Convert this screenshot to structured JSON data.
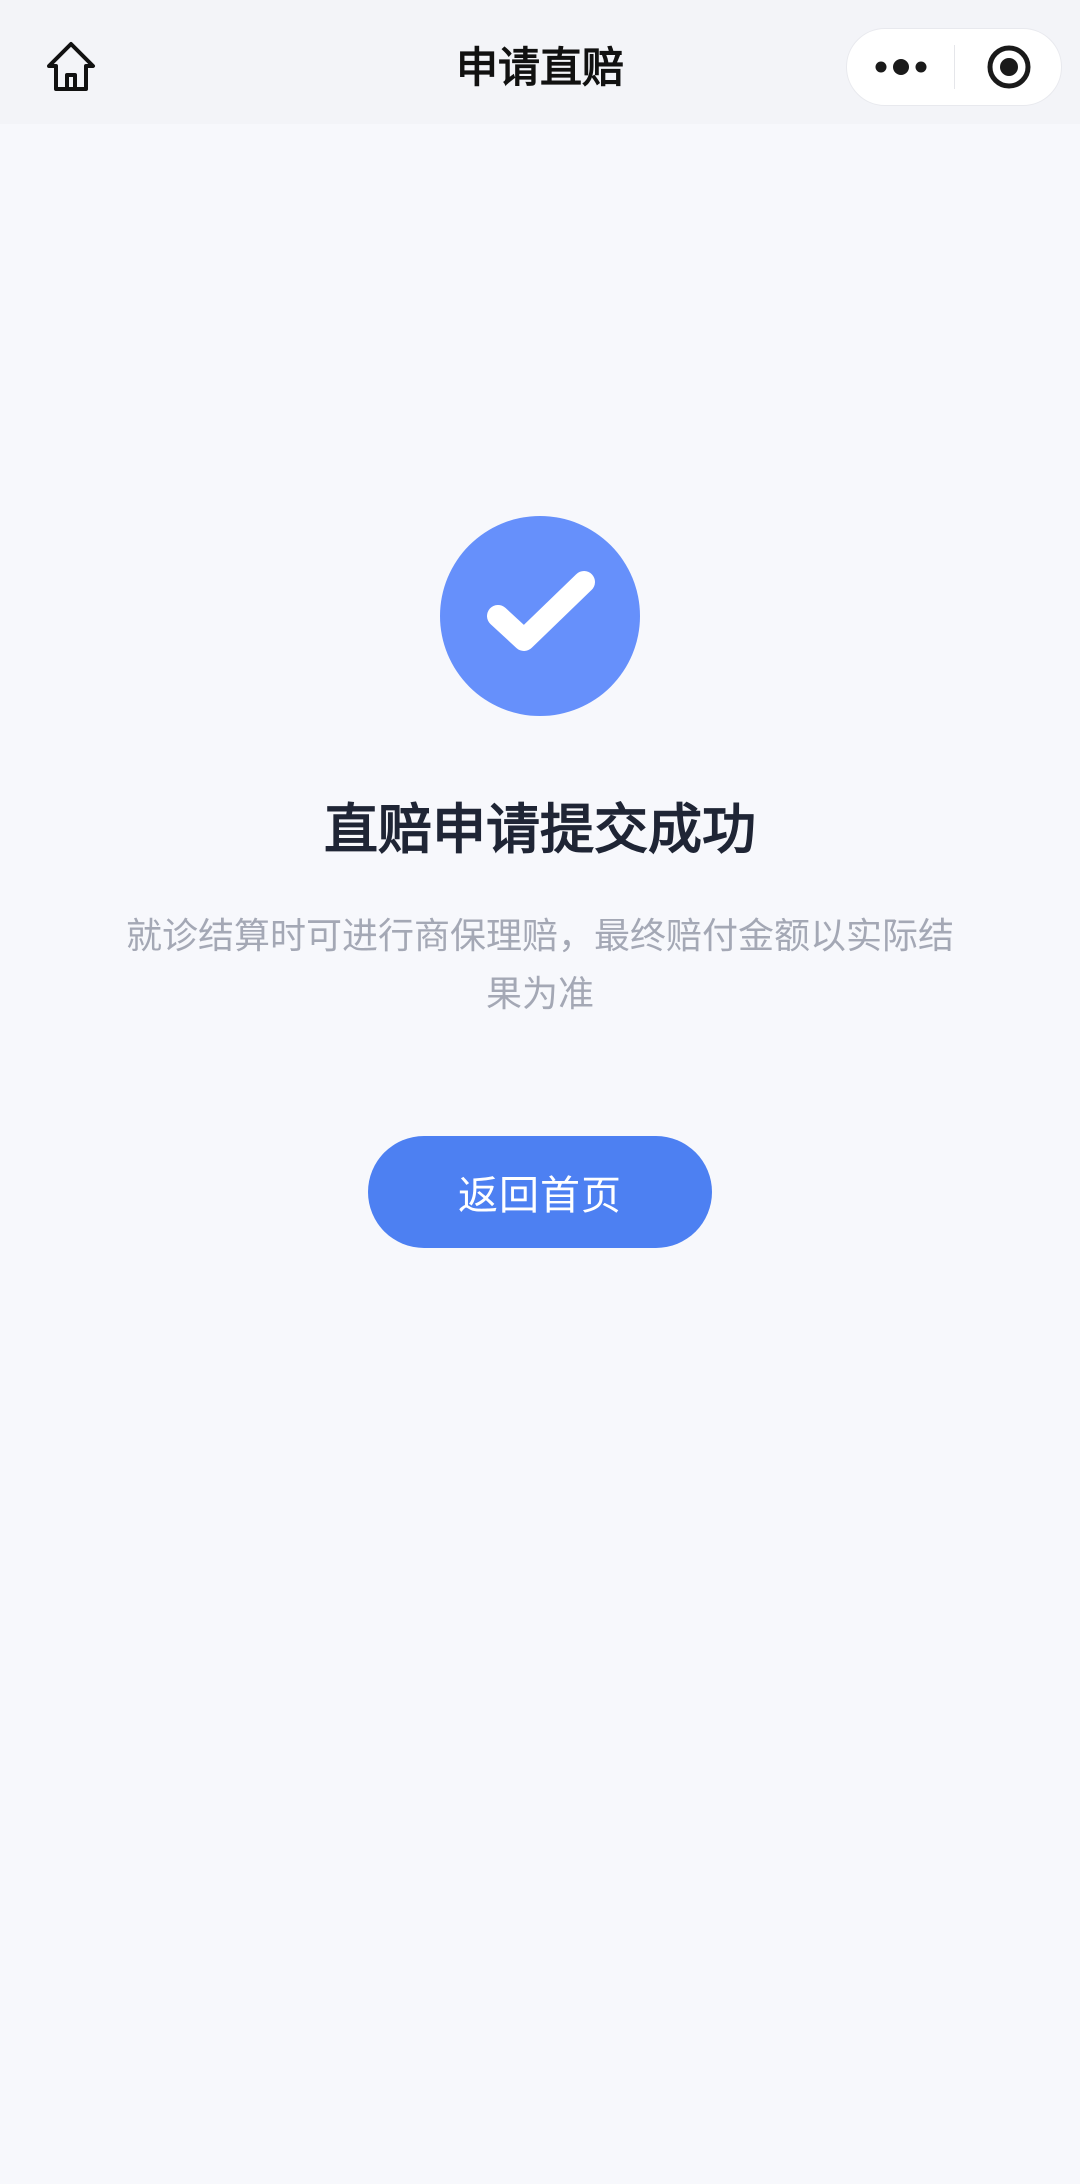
{
  "nav": {
    "title": "申请直赔",
    "home_icon": "home-icon",
    "more_icon": "more-dots-icon",
    "close_icon": "target-close-icon"
  },
  "result": {
    "icon": "check-circle-icon",
    "icon_color": "#6690fb",
    "title": "直赔申请提交成功",
    "description": "就诊结算时可进行商保理赔，最终赔付金额以实际结果为准"
  },
  "actions": {
    "home_button_label": "返回首页",
    "accent_color": "#4d80f2"
  }
}
